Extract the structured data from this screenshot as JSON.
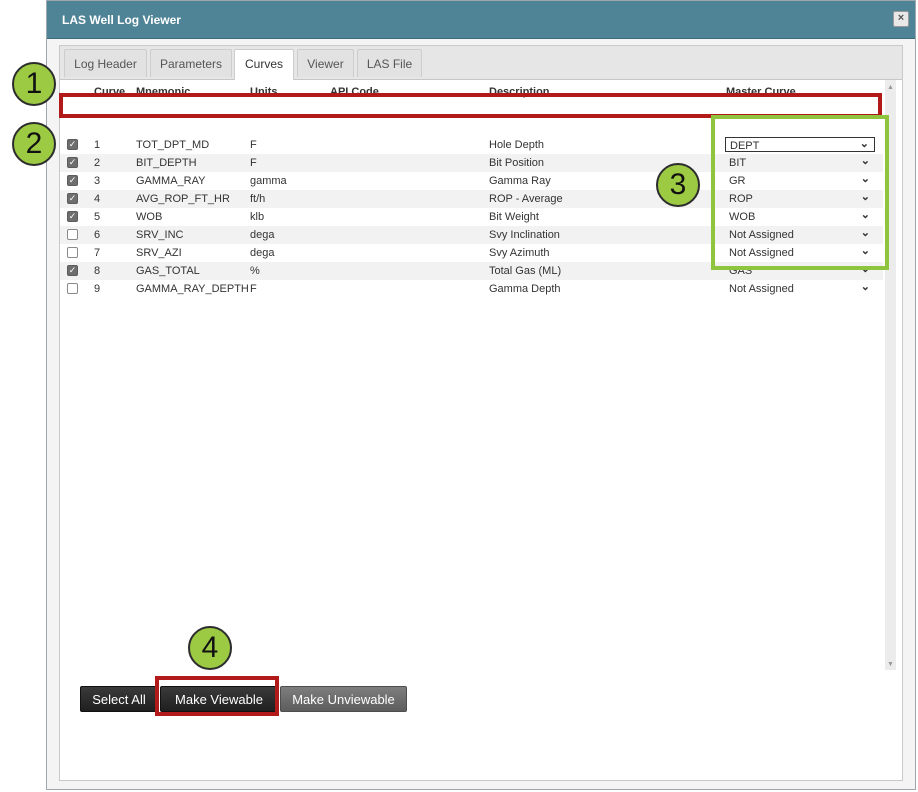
{
  "window": {
    "title": "LAS Well Log Viewer",
    "close_symbol": "×"
  },
  "tabs": [
    {
      "label": "Log Header",
      "active": false
    },
    {
      "label": "Parameters",
      "active": false
    },
    {
      "label": "Curves",
      "active": true
    },
    {
      "label": "Viewer",
      "active": false
    },
    {
      "label": "LAS File",
      "active": false
    }
  ],
  "table": {
    "headers": {
      "curve": "Curve",
      "mnemonic": "Mnemonic",
      "units": "Units",
      "api_code": "API Code",
      "description": "Description",
      "master_curve": "Master Curve"
    },
    "rows": [
      {
        "checked": true,
        "curve": "1",
        "mnemonic": "TOT_DPT_MD",
        "units": "F",
        "api_code": "",
        "description": "Hole Depth",
        "master": "DEPT"
      },
      {
        "checked": true,
        "curve": "2",
        "mnemonic": "BIT_DEPTH",
        "units": "F",
        "api_code": "",
        "description": "Bit Position",
        "master": "BIT"
      },
      {
        "checked": true,
        "curve": "3",
        "mnemonic": "GAMMA_RAY",
        "units": "gamma",
        "api_code": "",
        "description": "Gamma Ray",
        "master": "GR"
      },
      {
        "checked": true,
        "curve": "4",
        "mnemonic": "AVG_ROP_FT_HR",
        "units": "ft/h",
        "api_code": "",
        "description": "ROP - Average",
        "master": "ROP"
      },
      {
        "checked": true,
        "curve": "5",
        "mnemonic": "WOB",
        "units": "klb",
        "api_code": "",
        "description": "Bit Weight",
        "master": "WOB"
      },
      {
        "checked": false,
        "curve": "6",
        "mnemonic": "SRV_INC",
        "units": "dega",
        "api_code": "",
        "description": "Svy Inclination",
        "master": "Not Assigned"
      },
      {
        "checked": false,
        "curve": "7",
        "mnemonic": "SRV_AZI",
        "units": "dega",
        "api_code": "",
        "description": "Svy Azimuth",
        "master": "Not Assigned"
      },
      {
        "checked": true,
        "curve": "8",
        "mnemonic": "GAS_TOTAL",
        "units": "%",
        "api_code": "",
        "description": "Total Gas (ML)",
        "master": "GAS"
      },
      {
        "checked": false,
        "curve": "9",
        "mnemonic": "GAMMA_RAY_DEPTH",
        "units": "F",
        "api_code": "",
        "description": "Gamma Depth",
        "master": "Not Assigned"
      }
    ]
  },
  "buttons": {
    "select_all": "Select All",
    "make_viewable": "Make Viewable",
    "make_unviewable": "Make Unviewable"
  },
  "callouts": [
    "1",
    "2",
    "3",
    "4"
  ],
  "colors": {
    "titlebar": "#4f8396",
    "highlight_red": "#b21a1a",
    "highlight_green": "#8fc43f",
    "callout_fill": "#9ccb43"
  }
}
